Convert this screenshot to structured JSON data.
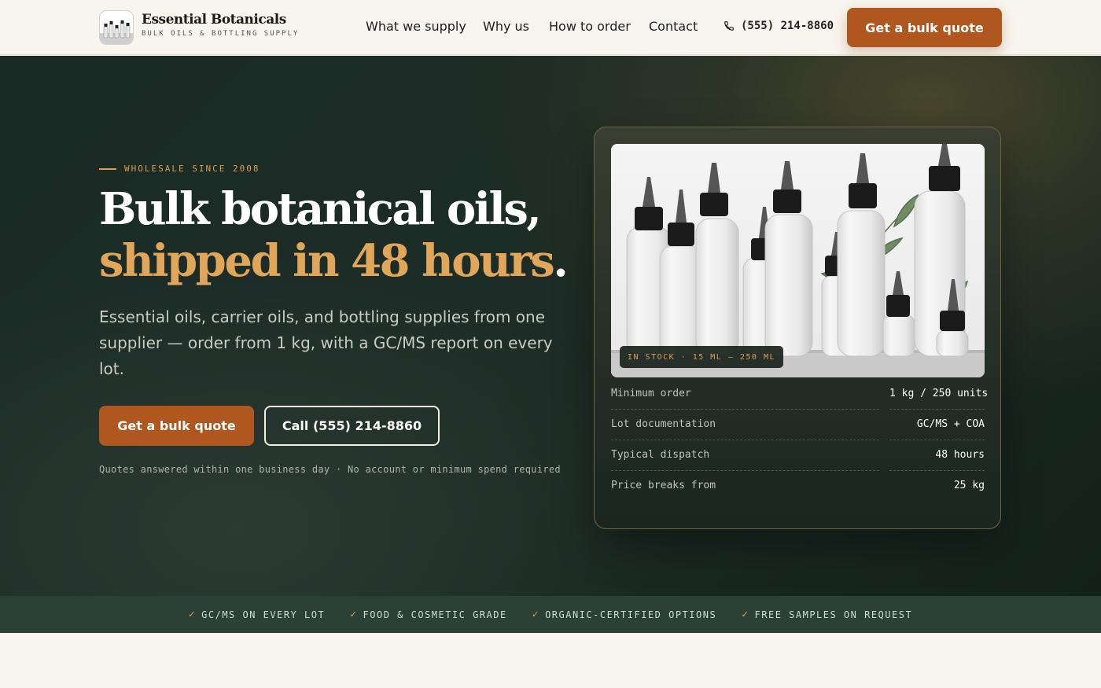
{
  "header": {
    "brand_name": "Essential Botanicals",
    "brand_tagline": "BULK OILS & BOTTLING SUPPLY",
    "nav": [
      "What we supply",
      "Why us",
      "How to order",
      "Contact"
    ],
    "phone": "(555) 214-8860",
    "cta": "Get a bulk quote"
  },
  "hero": {
    "eyebrow": "WHOLESALE SINCE 2008",
    "headline_line1": "Bulk botanical oils,",
    "headline_accent": "shipped in 48 hours",
    "headline_end": ".",
    "lead": "Essential oils, carrier oils, and bottling supplies from one supplier — order from 1 kg, with a GC/MS report on every lot.",
    "primary_button": "Get a bulk quote",
    "secondary_button": "Call (555) 214-8860",
    "note": "Quotes answered within one business day · No account or minimum spend required"
  },
  "card": {
    "badge": "IN STOCK · 15 ML – 250 ML",
    "specs": [
      {
        "label": "Minimum order",
        "value": "1 kg / 250 units"
      },
      {
        "label": "Lot documentation",
        "value": "GC/MS + COA"
      },
      {
        "label": "Typical dispatch",
        "value": "48 hours"
      },
      {
        "label": "Price breaks from",
        "value": "25 kg"
      }
    ]
  },
  "strip": [
    "GC/MS ON EVERY LOT",
    "FOOD & COSMETIC GRADE",
    "ORGANIC-CERTIFIED OPTIONS",
    "FREE SAMPLES ON REQUEST"
  ],
  "colors": {
    "accent": "#b0561f",
    "gold": "#d99f52",
    "dark": "#1d2c26",
    "cream": "#f8f5ee"
  }
}
